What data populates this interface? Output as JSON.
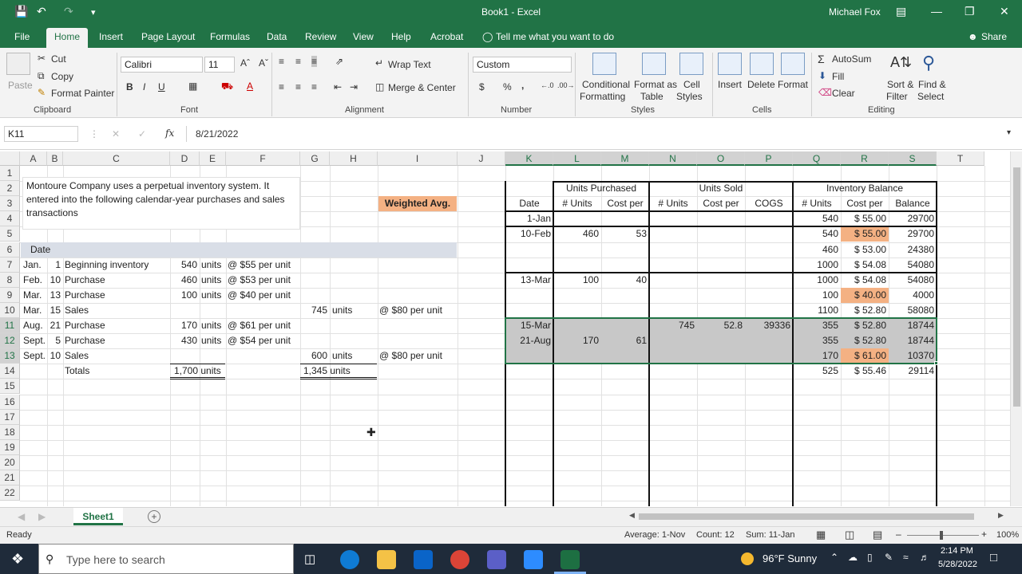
{
  "title_bar": {
    "doc_title": "Book1 - Excel",
    "user": "Michael Fox"
  },
  "menu": {
    "file": "File",
    "home": "Home",
    "insert": "Insert",
    "page_layout": "Page Layout",
    "formulas": "Formulas",
    "data": "Data",
    "review": "Review",
    "view": "View",
    "help": "Help",
    "acrobat": "Acrobat",
    "tell_me": "Tell me what you want to do",
    "share": "Share"
  },
  "ribbon": {
    "paste": "Paste",
    "cut": "Cut",
    "copy": "Copy",
    "format_painter": "Format Painter",
    "clipboard": "Clipboard",
    "font_name": "Calibri",
    "font_size": "11",
    "font": "Font",
    "bold": "B",
    "italic": "I",
    "underline": "U",
    "wrap_text": "Wrap Text",
    "merge_center": "Merge & Center",
    "alignment": "Alignment",
    "number_format": "Custom",
    "dollar": "$",
    "percent": "%",
    "comma": ",",
    "number": "Number",
    "conditional": "Conditional",
    "formatting": "Formatting",
    "format_as": "Format as",
    "table": "Table",
    "cell": "Cell",
    "styles_l": "Styles",
    "styles": "Styles",
    "insert": "Insert",
    "delete": "Delete",
    "format": "Format",
    "cells": "Cells",
    "autosum": "AutoSum",
    "fill": "Fill",
    "clear": "Clear",
    "sort": "Sort &",
    "filter": "Filter",
    "find": "Find &",
    "select": "Select",
    "editing": "Editing"
  },
  "formula_bar": {
    "name_box": "K11",
    "fx": "fx",
    "content": "8/21/2022"
  },
  "columns": [
    "A",
    "B",
    "C",
    "D",
    "E",
    "F",
    "G",
    "H",
    "I",
    "J",
    "K",
    "L",
    "M",
    "N",
    "O",
    "P",
    "Q",
    "R",
    "S",
    "T"
  ],
  "rows": [
    "1",
    "2",
    "3",
    "4",
    "5",
    "6",
    "7",
    "8",
    "9",
    "10",
    "11",
    "12",
    "13",
    "14",
    "15",
    "16",
    "17",
    "18",
    "19",
    "20",
    "21",
    "22"
  ],
  "left": {
    "intro": "Montoure Company uses a perpetual inventory system. It entered into the following calendar-year purchases and sales transactions",
    "weighted": "Weighted Avg.",
    "date_hdr": "Date",
    "lines": [
      {
        "m": "Jan.",
        "d": "1",
        "desc": "Beginning inventory",
        "u": "540",
        "unit": "units",
        "cost": "@ $55 per unit",
        "su": "",
        "sunit": "",
        "sc": ""
      },
      {
        "m": "Feb.",
        "d": "10",
        "desc": "Purchase",
        "u": "460",
        "unit": "units",
        "cost": "@ $53 per unit",
        "su": "",
        "sunit": "",
        "sc": ""
      },
      {
        "m": "Mar.",
        "d": "13",
        "desc": "Purchase",
        "u": "100",
        "unit": "units",
        "cost": "@ $40 per unit",
        "su": "",
        "sunit": "",
        "sc": ""
      },
      {
        "m": "Mar.",
        "d": "15",
        "desc": "Sales",
        "u": "",
        "unit": "",
        "cost": "",
        "su": "745",
        "sunit": "units",
        "sc": "@ $80 per unit"
      },
      {
        "m": "Aug.",
        "d": "21",
        "desc": "Purchase",
        "u": "170",
        "unit": "units",
        "cost": "@ $61 per unit",
        "su": "",
        "sunit": "",
        "sc": ""
      },
      {
        "m": "Sept.",
        "d": "5",
        "desc": "Purchase",
        "u": "430",
        "unit": "units",
        "cost": "@ $54 per unit",
        "su": "",
        "sunit": "",
        "sc": ""
      },
      {
        "m": "Sept.",
        "d": "10",
        "desc": "Sales",
        "u": "",
        "unit": "",
        "cost": "",
        "su": "600",
        "sunit": "units",
        "sc": "@ $80 per unit"
      }
    ],
    "totals": "Totals",
    "tot_p": "1,700 units",
    "tot_s": "1,345 units"
  },
  "right": {
    "h_purchased": "Units Purchased",
    "h_sold": "Units Sold",
    "h_balance": "Inventory Balance",
    "sub": [
      "Date",
      "# Units",
      "Cost per",
      "# Units",
      "Cost per",
      "COGS",
      "# Units",
      "Cost per",
      "Balance"
    ],
    "rows": [
      [
        "1-Jan",
        "",
        "",
        "",
        "",
        "",
        "540",
        "$ 55.00",
        "29700"
      ],
      [
        "10-Feb",
        "460",
        "53",
        "",
        "",
        "",
        "540",
        "$ 55.00",
        "29700"
      ],
      [
        "",
        "",
        "",
        "",
        "",
        "",
        "460",
        "$ 53.00",
        "24380"
      ],
      [
        "",
        "",
        "",
        "",
        "",
        "",
        "1000",
        "$ 54.08",
        "54080"
      ],
      [
        "13-Mar",
        "100",
        "40",
        "",
        "",
        "",
        "1000",
        "$ 54.08",
        "54080"
      ],
      [
        "",
        "",
        "",
        "",
        "",
        "",
        "100",
        "$ 40.00",
        "4000"
      ],
      [
        "",
        "",
        "",
        "",
        "",
        "",
        "1100",
        "$ 52.80",
        "58080"
      ],
      [
        "15-Mar",
        "",
        "",
        "745",
        "52.8",
        "39336",
        "355",
        "$ 52.80",
        "18744"
      ],
      [
        "21-Aug",
        "170",
        "61",
        "",
        "",
        "",
        "355",
        "$ 52.80",
        "18744"
      ],
      [
        "",
        "",
        "",
        "",
        "",
        "",
        "170",
        "$ 61.00",
        "10370"
      ],
      [
        "",
        "",
        "",
        "",
        "",
        "",
        "525",
        "$ 55.46",
        "29114"
      ]
    ]
  },
  "sheet": {
    "tab": "Sheet1",
    "add": "+"
  },
  "status": {
    "ready": "Ready",
    "average": "Average: 1-Nov",
    "count": "Count: 12",
    "sum": "Sum: 11-Jan",
    "zoom": "100%"
  },
  "taskbar": {
    "search": "Type here to search",
    "weather": "96°F  Sunny",
    "time": "2:14 PM",
    "date": "5/28/2022"
  },
  "colors": {
    "excel_green": "#217346",
    "orange": "#f4b183",
    "gray": "#c8c8c8"
  }
}
